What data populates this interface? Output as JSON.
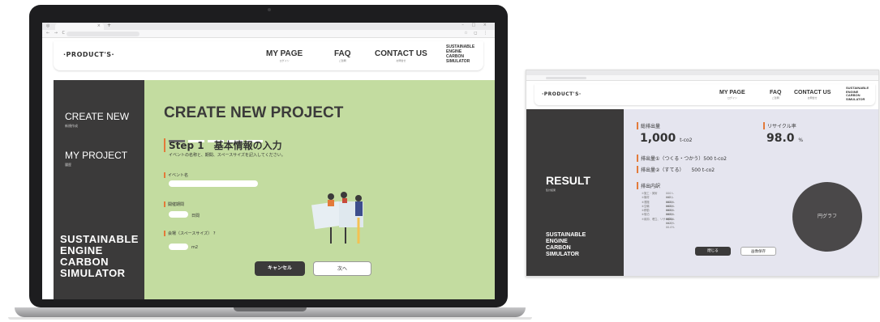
{
  "header": {
    "logo": "·PRODUCT'S·",
    "nav": [
      {
        "en": "MY PAGE",
        "jp": "ログイン"
      },
      {
        "en": "FAQ",
        "jp": "ご質問"
      },
      {
        "en": "CONTACT US",
        "jp": "お問合せ"
      }
    ],
    "brand": [
      "SUSTAINABLE",
      "ENGINE",
      "CARBON",
      "SIMULATOR"
    ]
  },
  "sidebar": {
    "items": [
      {
        "en": "CREATE NEW",
        "jp": "新規作成"
      },
      {
        "en": "MY PROJECT",
        "jp": "履歴"
      }
    ],
    "sim": [
      "SUSTAINABLE",
      "ENGINE",
      "CARBON",
      "SIMULATOR"
    ]
  },
  "create": {
    "title": "CREATE NEW PROJECT",
    "step_title": "Step 1　基本情報の入力",
    "step_desc": "イベントの名称と、期間、スペースサイズを記入してください。",
    "fields": {
      "event_name": "イベント名",
      "period": "開催期間",
      "period_unit": "日間",
      "venue": "会場（スペースサイズ）",
      "venue_unit": "m2"
    },
    "cancel": "キャンセル",
    "next": "次へ"
  },
  "result": {
    "title": "RESULT",
    "title_jp": "集計結果",
    "total_label": "総排出量",
    "total_value": "1,000",
    "total_unit": "t-co2",
    "recycle_label": "リサイクル率",
    "recycle_value": "98.0",
    "recycle_unit": "%",
    "em1": "排出量①（つくる・つかう）500 t-co2",
    "em2": "排出量②（すてる）　　500 t-co2",
    "breakdown_title": "排出内訳",
    "breakdown": [
      [
        "①施工・美術",
        "000 t-co2 / 00.0%"
      ],
      [
        "②機材",
        "000 t-co2 / 00.0%"
      ],
      [
        "③運搬",
        "000 t-co2 / 00.0%"
      ],
      [
        "④空輸",
        "000 t-co2 / 00.0%"
      ],
      [
        "⑤移動",
        "000 t-co2 / 00.0%"
      ],
      [
        "⑥宿泊",
        "000 t-co2 / 00.0%"
      ],
      [
        "⑦焼却、埋立、リサイクル",
        "000 t-co2 / 00.0%"
      ]
    ],
    "pie_label": "円グラフ",
    "close": "閉じる",
    "save": "画像保存"
  },
  "colors": {
    "accent": "#e37a3a",
    "dark": "#3b3a3a",
    "green": "#c3dca0",
    "result_bg": "#e5e5ef"
  }
}
